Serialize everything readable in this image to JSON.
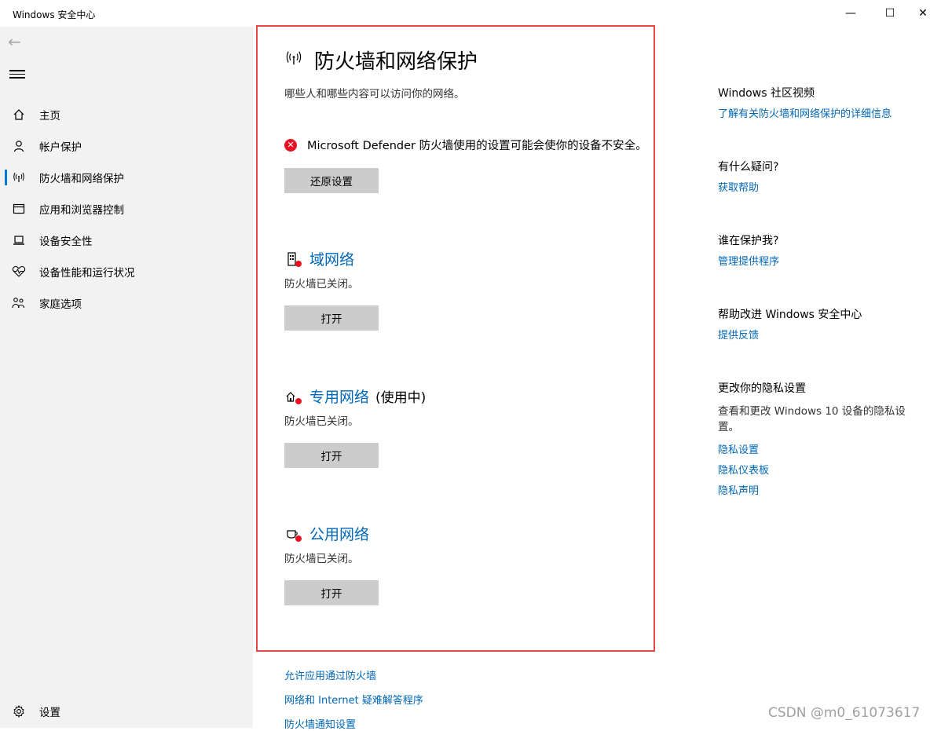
{
  "window": {
    "title": "Windows 安全中心",
    "minimize": "—",
    "maximize": "☐",
    "close": "✕"
  },
  "sidebar": {
    "items": [
      {
        "label": "主页"
      },
      {
        "label": "帐户保护"
      },
      {
        "label": "防火墙和网络保护"
      },
      {
        "label": "应用和浏览器控制"
      },
      {
        "label": "设备安全性"
      },
      {
        "label": "设备性能和运行状况"
      },
      {
        "label": "家庭选项"
      }
    ],
    "settings_label": "设置"
  },
  "main": {
    "title": "防火墙和网络保护",
    "subtitle": "哪些人和哪些内容可以访问你的网络。",
    "warning": "Microsoft Defender 防火墙使用的设置可能会使你的设备不安全。",
    "restore_button": "还原设置",
    "networks": [
      {
        "name": "域网络",
        "tag": "",
        "status": "防火墙已关闭。",
        "button": "打开"
      },
      {
        "name": "专用网络",
        "tag": "(使用中)",
        "status": "防火墙已关闭。",
        "button": "打开"
      },
      {
        "name": "公用网络",
        "tag": "",
        "status": "防火墙已关闭。",
        "button": "打开"
      }
    ],
    "links": [
      "允许应用通过防火墙",
      "网络和 Internet 疑难解答程序",
      "防火墙通知设置"
    ]
  },
  "right": {
    "community": {
      "heading": "Windows 社区视频",
      "link": "了解有关防火墙和网络保护的详细信息"
    },
    "question": {
      "heading": "有什么疑问?",
      "link": "获取帮助"
    },
    "protector": {
      "heading": "谁在保护我?",
      "link": "管理提供程序"
    },
    "improve": {
      "heading": "帮助改进 Windows 安全中心",
      "link": "提供反馈"
    },
    "privacy": {
      "heading": "更改你的隐私设置",
      "text": "查看和更改 Windows 10 设备的隐私设置。",
      "links": [
        "隐私设置",
        "隐私仪表板",
        "隐私声明"
      ]
    }
  },
  "watermark": "CSDN @m0_61073617",
  "colors": {
    "accent": "#0067b8",
    "error": "#e81123",
    "highlight_border": "#e84646",
    "button": "#cccccc",
    "sidebar": "#f2f2f2"
  }
}
